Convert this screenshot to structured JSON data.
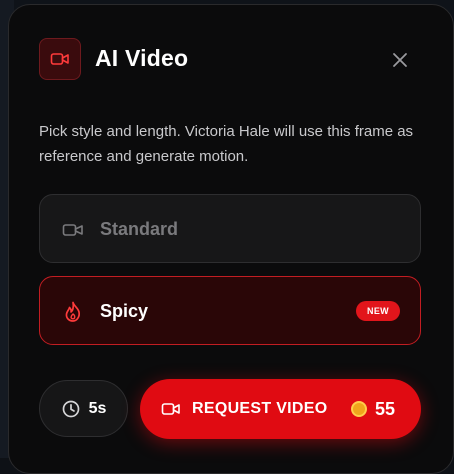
{
  "modal": {
    "title": "AI Video",
    "description": "Pick style and length. Victoria Hale will use this frame as reference and generate motion."
  },
  "options": [
    {
      "label": "Standard",
      "icon": "video-camera-icon",
      "selected": false
    },
    {
      "label": "Spicy",
      "icon": "flame-icon",
      "selected": true,
      "badge": "NEW"
    }
  ],
  "footer": {
    "duration_label": "5s",
    "request_label": "REQUEST VIDEO",
    "cost": "55",
    "cost_icon": "coin-icon"
  },
  "colors": {
    "accent": "#e00b12",
    "modal_bg": "#0b0b0c",
    "spicy_bg": "#2a0607",
    "spicy_border": "#c21d22"
  }
}
